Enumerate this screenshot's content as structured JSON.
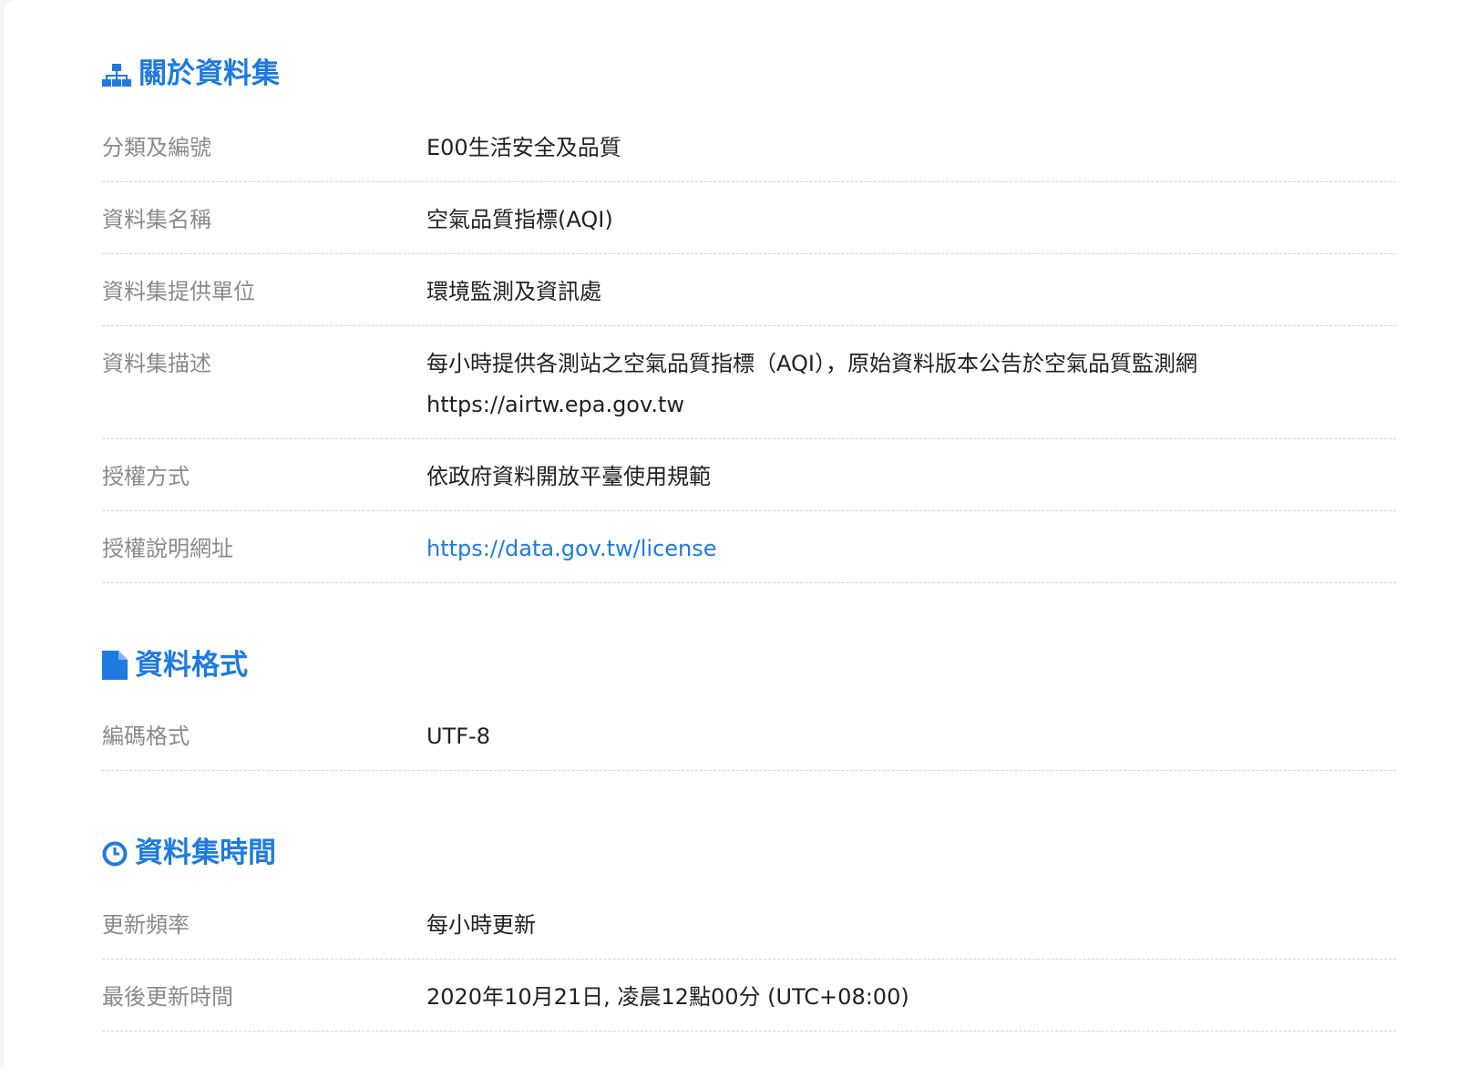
{
  "colors": {
    "accent": "#1f7ae0",
    "label": "#8a8a8a",
    "value": "#222222"
  },
  "sections": {
    "about": {
      "icon": "sitemap-icon",
      "title": "關於資料集",
      "rows": [
        {
          "label": "分類及編號",
          "value": "E00生活安全及品質"
        },
        {
          "label": "資料集名稱",
          "value": "空氣品質指標(AQI)"
        },
        {
          "label": "資料集提供單位",
          "value": "環境監測及資訊處"
        },
        {
          "label": "資料集描述",
          "value_line1": "每小時提供各測站之空氣品質指標（AQI），原始資料版本公告於空氣品質監測網",
          "value_line2": "https://airtw.epa.gov.tw"
        },
        {
          "label": "授權方式",
          "value": "依政府資料開放平臺使用規範"
        },
        {
          "label": "授權說明網址",
          "value": "https://data.gov.tw/license"
        }
      ]
    },
    "format": {
      "icon": "file-icon",
      "title": "資料格式",
      "rows": [
        {
          "label": "編碼格式",
          "value": "UTF-8"
        }
      ]
    },
    "time": {
      "icon": "clock-icon",
      "title": "資料集時間",
      "rows": [
        {
          "label": "更新頻率",
          "value": "每小時更新"
        },
        {
          "label": "最後更新時間",
          "value": "2020年10月21日, 凌晨12點00分 (UTC+08:00)"
        }
      ]
    }
  }
}
